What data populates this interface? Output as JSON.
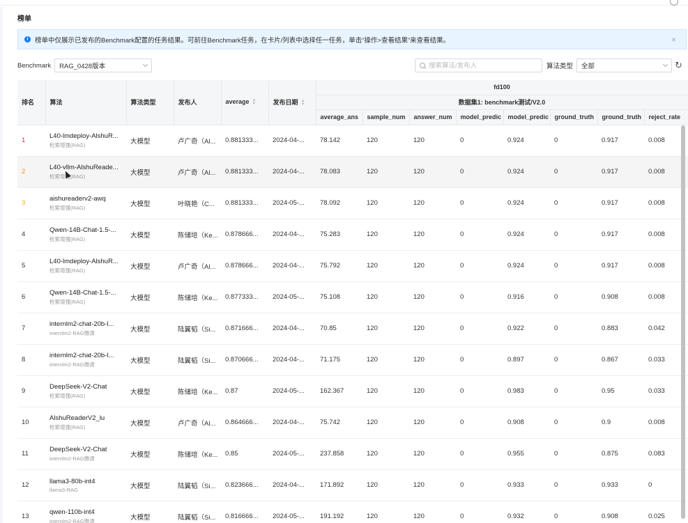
{
  "page": {
    "title": "榜单"
  },
  "alert": {
    "text": "榜单中仅展示已发布的Benchmark配置的任务结果。可前往Benchmark任务，在卡片/列表中选择任一任务，单击“操作>查看结果”来查看结果。"
  },
  "filters": {
    "benchmark_label": "Benchmark",
    "benchmark_value": "RAG_0428版本",
    "search_placeholder": "搜索算法/发布人",
    "algo_type_label": "算法类型",
    "algo_type_value": "全部"
  },
  "table": {
    "group_header": "fd100",
    "dataset_header": "数据集1: benchmark测试/V2.0",
    "columns": {
      "rank": "排名",
      "algo": "算法",
      "type": "算法类型",
      "publisher": "发布人",
      "average": "average",
      "date": "发布日期",
      "m1": "average_ans",
      "m2": "sample_num",
      "m3": "answer_num",
      "m4": "model_predic",
      "m5": "model_predic",
      "m6": "ground_truth",
      "m7": "ground_truth",
      "m8": "reject_rate"
    },
    "rows": [
      {
        "rank": "1",
        "name": "L40-lmdeploy-AlshuR...",
        "sub": "检索增强(RAG)",
        "type": "大模型",
        "publisher": "卢广奇（Al...",
        "average": "0.881333...",
        "date": "2024-04-...",
        "m1": "78.142",
        "m2": "120",
        "m3": "120",
        "m4": "0",
        "m5": "0.924",
        "m6": "0",
        "m7": "0.917",
        "m8": "0.008"
      },
      {
        "rank": "2",
        "name": "L40-vllm-AlshuReade...",
        "sub": "检索增强(RAG)",
        "type": "大模型",
        "publisher": "卢广奇（Al...",
        "average": "0.881333...",
        "date": "2024-04-...",
        "m1": "78.083",
        "m2": "120",
        "m3": "120",
        "m4": "0",
        "m5": "0.924",
        "m6": "0",
        "m7": "0.917",
        "m8": "0.008"
      },
      {
        "rank": "3",
        "name": "aishureaderv2-awq",
        "sub": "检索增强(RAG)",
        "type": "大模型",
        "publisher": "叶晓艳（C...",
        "average": "0.881333...",
        "date": "2024-05-...",
        "m1": "78.092",
        "m2": "120",
        "m3": "120",
        "m4": "0",
        "m5": "0.924",
        "m6": "0",
        "m7": "0.917",
        "m8": "0.008"
      },
      {
        "rank": "4",
        "name": "Qwen-14B-Chat-1.5-...",
        "sub": "检索增强(RAG)",
        "type": "大模型",
        "publisher": "陈储培（Ke...",
        "average": "0.878666...",
        "date": "2024-04-...",
        "m1": "75.283",
        "m2": "120",
        "m3": "120",
        "m4": "0",
        "m5": "0.924",
        "m6": "0",
        "m7": "0.917",
        "m8": "0.008"
      },
      {
        "rank": "5",
        "name": "L40-lmdeploy-AlshuR...",
        "sub": "检索增强(RAG)",
        "type": "大模型",
        "publisher": "卢广奇（Al...",
        "average": "0.878666...",
        "date": "2024-04-...",
        "m1": "75.792",
        "m2": "120",
        "m3": "120",
        "m4": "0",
        "m5": "0.924",
        "m6": "0",
        "m7": "0.917",
        "m8": "0.008"
      },
      {
        "rank": "6",
        "name": "Qwen-14B-Chat-1.5-...",
        "sub": "检索增强(RAG)",
        "type": "大模型",
        "publisher": "陈储培（Ke...",
        "average": "0.877333...",
        "date": "2024-05-...",
        "m1": "75.108",
        "m2": "120",
        "m3": "120",
        "m4": "0",
        "m5": "0.916",
        "m6": "0",
        "m7": "0.908",
        "m8": "0.008"
      },
      {
        "rank": "7",
        "name": "internlm2-chat-20b-l...",
        "sub": "internlm2-RAG微调",
        "type": "大模型",
        "publisher": "陆翼韬（Si...",
        "average": "0.871666...",
        "date": "2024-04-...",
        "m1": "70.85",
        "m2": "120",
        "m3": "120",
        "m4": "0",
        "m5": "0.922",
        "m6": "0",
        "m7": "0.883",
        "m8": "0.042"
      },
      {
        "rank": "8",
        "name": "internlm2-chat-20b-l...",
        "sub": "internlm2-RAG微调",
        "type": "大模型",
        "publisher": "陆翼韬（Si...",
        "average": "0.870666...",
        "date": "2024-04-...",
        "m1": "71.175",
        "m2": "120",
        "m3": "120",
        "m4": "0",
        "m5": "0.897",
        "m6": "0",
        "m7": "0.867",
        "m8": "0.033"
      },
      {
        "rank": "9",
        "name": "DeepSeek-V2-Chat",
        "sub": "检索增强(RAG)",
        "type": "大模型",
        "publisher": "陈储培（Ke...",
        "average": "0.87",
        "date": "2024-05-...",
        "m1": "162.367",
        "m2": "120",
        "m3": "120",
        "m4": "0",
        "m5": "0.983",
        "m6": "0",
        "m7": "0.95",
        "m8": "0.033"
      },
      {
        "rank": "10",
        "name": "AlshuReaderV2_lu",
        "sub": "检索增强(RAG)",
        "type": "大模型",
        "publisher": "卢广奇（Al...",
        "average": "0.864666...",
        "date": "2024-04-...",
        "m1": "75.742",
        "m2": "120",
        "m3": "120",
        "m4": "0",
        "m5": "0.908",
        "m6": "0",
        "m7": "0.9",
        "m8": "0.008"
      },
      {
        "rank": "11",
        "name": "DeepSeek-V2-Chat",
        "sub": "internlm2-RAG微调",
        "type": "大模型",
        "publisher": "陈储培（Ke...",
        "average": "0.85",
        "date": "2024-05-...",
        "m1": "237.858",
        "m2": "120",
        "m3": "120",
        "m4": "0",
        "m5": "0.955",
        "m6": "0",
        "m7": "0.875",
        "m8": "0.083"
      },
      {
        "rank": "12",
        "name": "llama3-80b-int4",
        "sub": "llama3-RAG",
        "type": "大模型",
        "publisher": "陆翼韬（Si...",
        "average": "0.823666...",
        "date": "2024-04-...",
        "m1": "171.892",
        "m2": "120",
        "m3": "120",
        "m4": "0",
        "m5": "0.933",
        "m6": "0",
        "m7": "0.933",
        "m8": "0"
      },
      {
        "rank": "13",
        "name": "qwen-110b-int4",
        "sub": "internlm2-RAG微调",
        "type": "大模型",
        "publisher": "陆翼韬（Si...",
        "average": "0.816666...",
        "date": "2024-05-...",
        "m1": "191.192",
        "m2": "120",
        "m3": "120",
        "m4": "0",
        "m5": "0.932",
        "m6": "0",
        "m7": "0.908",
        "m8": "0.025"
      }
    ]
  }
}
